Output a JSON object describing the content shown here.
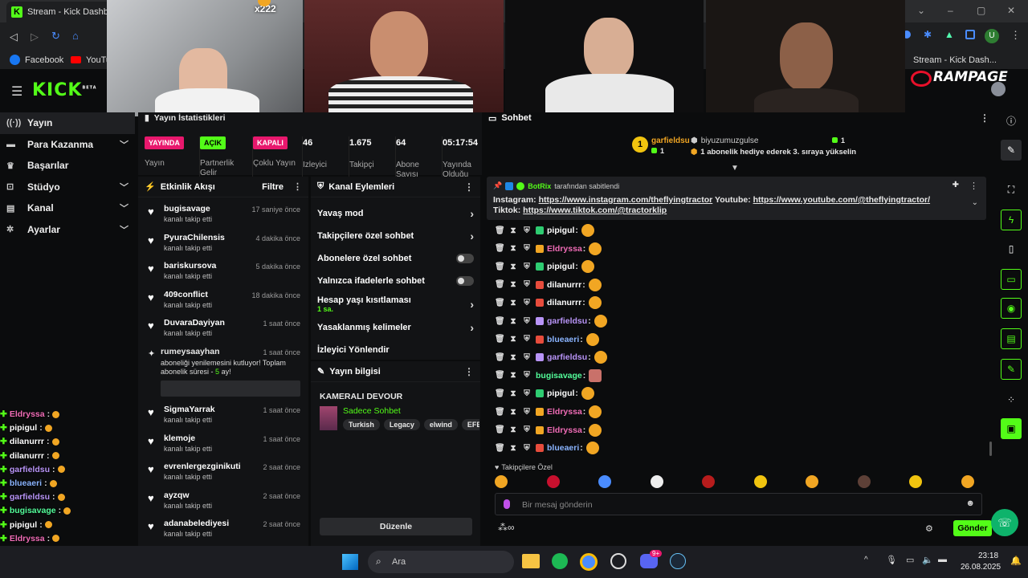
{
  "browser": {
    "tab_title": "Stream - Kick Dashbo",
    "bookmarks": [
      {
        "label": "Facebook"
      },
      {
        "label": "YouTu"
      }
    ],
    "right_tab_title": "Stream - Kick Dash...",
    "rampage_label": "RAMPAGE",
    "profile_initial": "U"
  },
  "overlay": {
    "donation_label": "x222"
  },
  "nav": {
    "items": [
      {
        "label": "Yayın",
        "icon": "broadcast-icon",
        "expandable": false
      },
      {
        "label": "Para Kazanma",
        "icon": "money-icon",
        "expandable": true
      },
      {
        "label": "Başarılar",
        "icon": "trophy-icon",
        "expandable": false
      },
      {
        "label": "Stüdyo",
        "icon": "studio-icon",
        "expandable": true
      },
      {
        "label": "Kanal",
        "icon": "channel-icon",
        "expandable": true
      },
      {
        "label": "Ayarlar",
        "icon": "settings-icon",
        "expandable": true
      }
    ]
  },
  "overlay_chat": [
    {
      "user": "Eldryssa",
      "color": "#f06cb6",
      "sep": ":"
    },
    {
      "user": "pipigul",
      "color": "#ffffff",
      "sep": ":"
    },
    {
      "user": "dilanurrr",
      "color": "#ffffff",
      "sep": ":"
    },
    {
      "user": "dilanurrr",
      "color": "#ffffff",
      "sep": ":"
    },
    {
      "user": "garfieldsu",
      "color": "#b894f7",
      "sep": ":"
    },
    {
      "user": "blueaeri",
      "color": "#8ab4ff",
      "sep": ":"
    },
    {
      "user": "garfieldsu",
      "color": "#b894f7",
      "sep": ":"
    },
    {
      "user": "bugisavage",
      "color": "#53fc9a",
      "sep": ":"
    },
    {
      "user": "pipigul",
      "color": "#ffffff",
      "sep": ":"
    },
    {
      "user": "Eldryssa",
      "color": "#f06cb6",
      "sep": ":"
    },
    {
      "user": "Eldryssa",
      "color": "#f06cb6",
      "sep": ":"
    },
    {
      "user": "blueaeri",
      "color": "#8ab4ff",
      "sep": ":"
    }
  ],
  "stats": {
    "title": "Yayın İstatistikleri",
    "items": [
      {
        "pill": "YAYINDA",
        "pill_color": "#e8186d",
        "label": "Yayın"
      },
      {
        "pill": "AÇIK",
        "pill_color": "#53fc18",
        "label": "Partnerlik Gelir"
      },
      {
        "pill": "KAPALI",
        "pill_color": "#e8186d",
        "label": "Çoklu Yayın"
      },
      {
        "value": "46",
        "label": "İzleyici"
      },
      {
        "value": "1.675",
        "label": "Takipçi"
      },
      {
        "value": "64",
        "label": "Abone Sayısı"
      },
      {
        "value": "05:17:54",
        "label": "Yayında Olduğu"
      }
    ]
  },
  "activity": {
    "title": "Etkinlik Akışı",
    "filter": "Filtre",
    "items": [
      {
        "name": "bugisavage",
        "sub": "kanalı takip etti",
        "time": "17 saniye önce"
      },
      {
        "name": "PyuraChilensis",
        "sub": "kanalı takip etti",
        "time": "4 dakika önce"
      },
      {
        "name": "bariskursova",
        "sub": "kanalı takip etti",
        "time": "5 dakika önce"
      },
      {
        "name": "409conflict",
        "sub": "kanalı takip etti",
        "time": "18 dakika önce"
      },
      {
        "name": "DuvaraDayiyan",
        "sub": "kanalı takip etti",
        "time": "1 saat önce"
      }
    ],
    "resub": {
      "name": "rumeysaayhan",
      "time": "1 saat önce",
      "text_a": "aboneliği yenilemesini kutluyor! Toplam abonelik süresi - ",
      "months": "5",
      "text_b": " ay!"
    },
    "items2": [
      {
        "name": "SigmaYarrak",
        "sub": "kanalı takip etti",
        "time": "1 saat önce"
      },
      {
        "name": "klemoje",
        "sub": "kanalı takip etti",
        "time": "1 saat önce"
      },
      {
        "name": "evrenlergezginikuti",
        "sub": "kanalı takip etti",
        "time": "2 saat önce"
      },
      {
        "name": "ayzqw",
        "sub": "kanalı takip etti",
        "time": "2 saat önce"
      },
      {
        "name": "adanabelediyesi",
        "sub": "kanalı takip etti",
        "time": "2 saat önce"
      }
    ]
  },
  "channel_actions": {
    "title": "Kanal Eylemleri",
    "slow": "Yavaş mod",
    "followers": "Takipçilere özel sohbet",
    "subs": "Abonelere özel sohbet",
    "emotes": "Yalnızca ifadelerle sohbet",
    "age": "Hesap yaşı kısıtlaması",
    "age_value": "1 sa.",
    "banned": "Yasaklanmış kelimeler",
    "redirect": "İzleyici Yönlendir"
  },
  "stream_info": {
    "title": "Yayın bilgisi",
    "stream_title": "KAMERALI DEVOUR",
    "category": "Sadece Sohbet",
    "tags": [
      "Turkish",
      "Legacy",
      "elwind",
      "EFEUYG"
    ],
    "edit": "Düzenle"
  },
  "chat": {
    "title": "Sohbet",
    "leader1_rank": "1",
    "leader1_name": "garfieldsu",
    "leader1_count": "1",
    "leader2_name": "biyuzumuzgulse",
    "leader2_count": "1",
    "leader2_text": "1 abonelik hediye ederek 3. sıraya yükselin",
    "pinned_by": "BotRix",
    "pinned_suffix": "tarafından sabitlendi",
    "pinned_a": "Instagram: ",
    "pinned_link1": "https://www.instagram.com/theflyingtractor",
    "pinned_b": " Youtube: ",
    "pinned_link2": "https://www.youtube.com/@theflyingtractor/",
    "pinned_c": " Tiktok: ",
    "pinned_link3": "https://www.tiktok.com/@tractorklip",
    "messages": [
      {
        "user": "pipigul",
        "color": "#ffffff",
        "badge": "#2ecc71"
      },
      {
        "user": "Eldryssa",
        "color": "#f06cb6",
        "badge": "#f1a623"
      },
      {
        "user": "pipigul",
        "color": "#ffffff",
        "badge": "#2ecc71"
      },
      {
        "user": "dilanurrr",
        "color": "#ffffff",
        "badge": "#e74c3c"
      },
      {
        "user": "dilanurrr",
        "color": "#ffffff",
        "badge": "#e74c3c"
      },
      {
        "user": "garfieldsu",
        "color": "#b894f7",
        "badge": "#b894f7"
      },
      {
        "user": "blueaeri",
        "color": "#8ab4ff",
        "badge": "#e74c3c"
      },
      {
        "user": "garfieldsu",
        "color": "#b894f7",
        "badge": "#b894f7"
      },
      {
        "user": "bugisavage",
        "color": "#53fc9a",
        "badge": ""
      },
      {
        "user": "pipigul",
        "color": "#ffffff",
        "badge": "#2ecc71"
      },
      {
        "user": "Eldryssa",
        "color": "#f06cb6",
        "badge": "#f1a623"
      },
      {
        "user": "Eldryssa",
        "color": "#f06cb6",
        "badge": "#f1a623"
      },
      {
        "user": "blueaeri",
        "color": "#8ab4ff",
        "badge": "#e74c3c"
      }
    ],
    "followers_only": "Takipçilere Özel",
    "placeholder": "Bir mesaj gönderin",
    "send": "Gönder"
  },
  "taskbar": {
    "search": "Ara",
    "time": "23:18",
    "date": "26.08.2025",
    "steam_badge": "9+"
  },
  "colors": {
    "kick_green": "#53fc18",
    "live_red": "#e8186d"
  }
}
